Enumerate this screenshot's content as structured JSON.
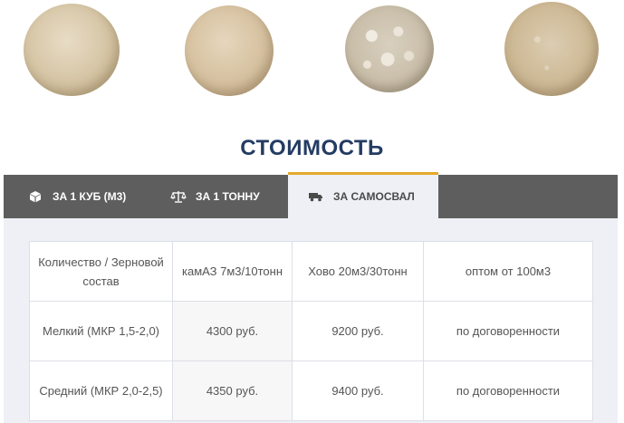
{
  "samples": [
    {
      "icon": "sand-sample-1"
    },
    {
      "icon": "sand-sample-2"
    },
    {
      "icon": "gravel-sample-3"
    },
    {
      "icon": "sand-sample-4"
    }
  ],
  "section": {
    "title": "СТОИМОСТЬ"
  },
  "tabs": [
    {
      "label": "ЗА 1 КУБ (М3)",
      "icon": "cube-icon"
    },
    {
      "label": "ЗА 1 ТОННУ",
      "icon": "scales-icon"
    },
    {
      "label": "ЗА САМОСВАЛ",
      "icon": "truck-icon",
      "active": true
    }
  ],
  "colors": {
    "accent": "#e5a92b",
    "title": "#243c63",
    "tabbar": "#5e5e5e",
    "panel": "#eef0f6"
  },
  "table": {
    "headers": [
      "Количество / Зерновой состав",
      "камАЗ 7м3/10тонн",
      "Хово 20м3/30тонн",
      "оптом от 100м3"
    ],
    "rows": [
      [
        "Мелкий (МКР 1,5-2,0)",
        "4300 руб.",
        "9200 руб.",
        "по договоренности"
      ],
      [
        "Средний (МКР 2,0-2,5)",
        "4350 руб.",
        "9400 руб.",
        "по договоренности"
      ]
    ]
  }
}
